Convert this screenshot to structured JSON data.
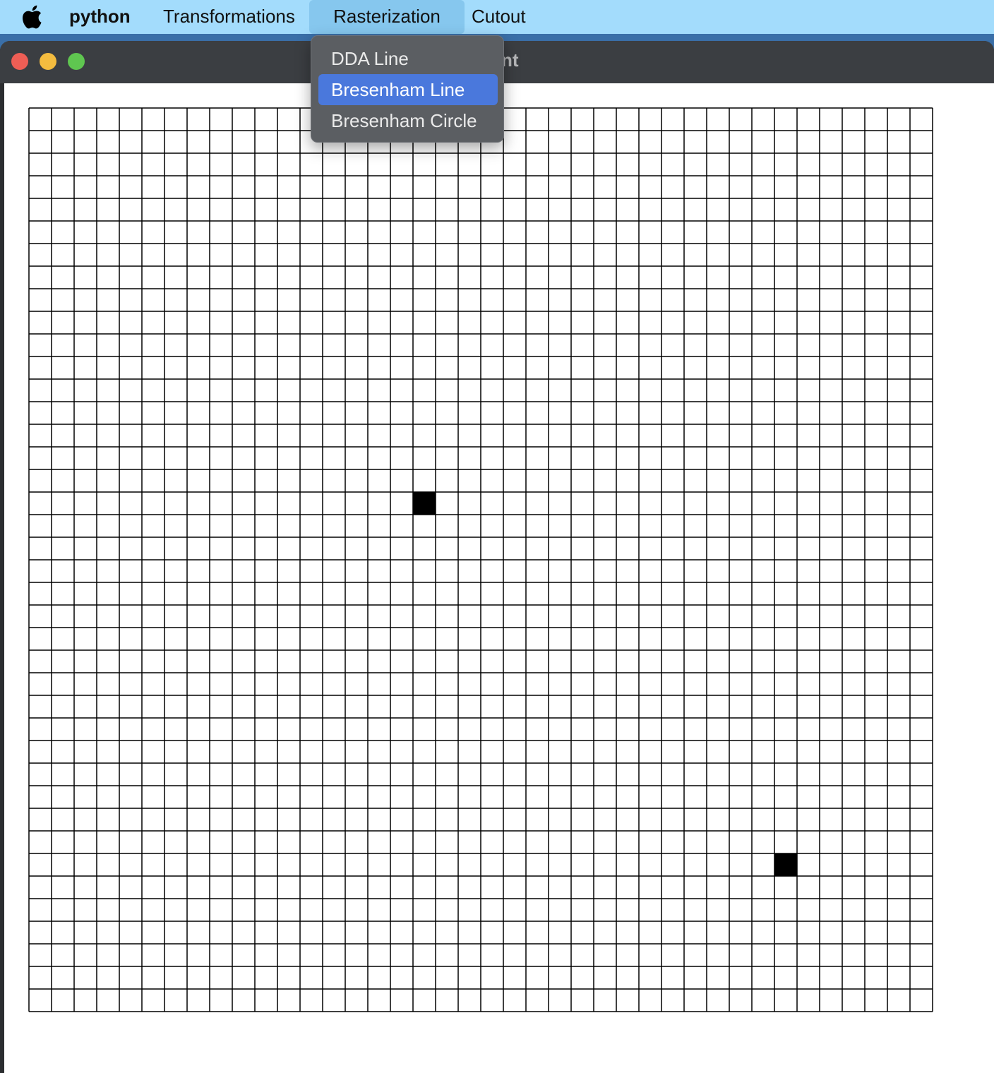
{
  "menubar": {
    "apple_icon": "apple-logo-icon",
    "app_name": "python",
    "items": [
      "Transformations",
      "Rasterization",
      "Cutout"
    ],
    "active_item": "Rasterization"
  },
  "window": {
    "title_visible_fragment": "nt",
    "controls": {
      "close_color": "#ee5e55",
      "minimize_color": "#f4bc3f",
      "zoom_color": "#5fc650"
    }
  },
  "dropdown": {
    "items": [
      "DDA Line",
      "Bresenham Line",
      "Bresenham Circle"
    ],
    "highlighted": "Bresenham Line",
    "highlight_color": "#4a78dc"
  },
  "canvas": {
    "grid_columns": 40,
    "grid_rows": 40,
    "filled_cells": [
      {
        "col": 17,
        "row": 17
      },
      {
        "col": 33,
        "row": 33
      }
    ]
  }
}
